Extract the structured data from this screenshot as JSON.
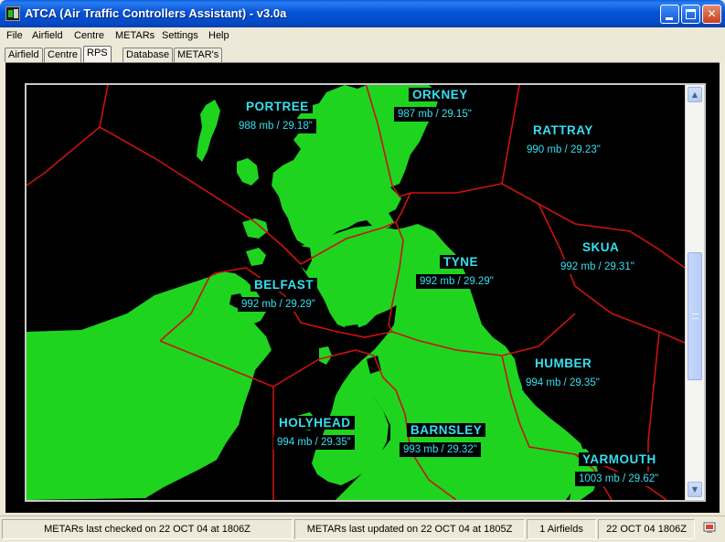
{
  "window": {
    "title": "ATCA (Air Traffic Controllers Assistant) - v3.0a",
    "title_color": "#0553d8"
  },
  "menu": [
    "File",
    "Airfield",
    "Centre",
    "METARs",
    "Settings",
    "Help"
  ],
  "tabs": [
    {
      "label": "Airfield",
      "active": false
    },
    {
      "label": "Centre",
      "active": false
    },
    {
      "label": "RPS",
      "active": true
    },
    {
      "label": "Database",
      "active": false
    },
    {
      "label": "METAR's",
      "active": false
    }
  ],
  "map": {
    "land_color": "#1fd41f",
    "boundary_color": "#cc1111",
    "label_color": "#35e0f0",
    "regions": [
      {
        "name": "PORTREE",
        "pressure": "988 mb / 29.18\""
      },
      {
        "name": "ORKNEY",
        "pressure": "987 mb / 29.15\""
      },
      {
        "name": "RATTRAY",
        "pressure": "990 mb / 29.23\""
      },
      {
        "name": "SKUA",
        "pressure": "992 mb / 29.31\""
      },
      {
        "name": "TYNE",
        "pressure": "992 mb / 29.29\""
      },
      {
        "name": "BELFAST",
        "pressure": "992 mb / 29.29\""
      },
      {
        "name": "HUMBER",
        "pressure": "994 mb / 29.35\""
      },
      {
        "name": "HOLYHEAD",
        "pressure": "994 mb / 29.35\""
      },
      {
        "name": "BARNSLEY",
        "pressure": "993 mb / 29.32\""
      },
      {
        "name": "YARMOUTH",
        "pressure": "1003 mb / 29.62\""
      }
    ]
  },
  "status": {
    "checked": "METARs last checked on 22 OCT 04 at 1806Z",
    "updated": "METARs last updated on 22 OCT 04 at 1805Z",
    "airfields": "1 Airfields",
    "datetime": "22 OCT 04 1806Z"
  }
}
